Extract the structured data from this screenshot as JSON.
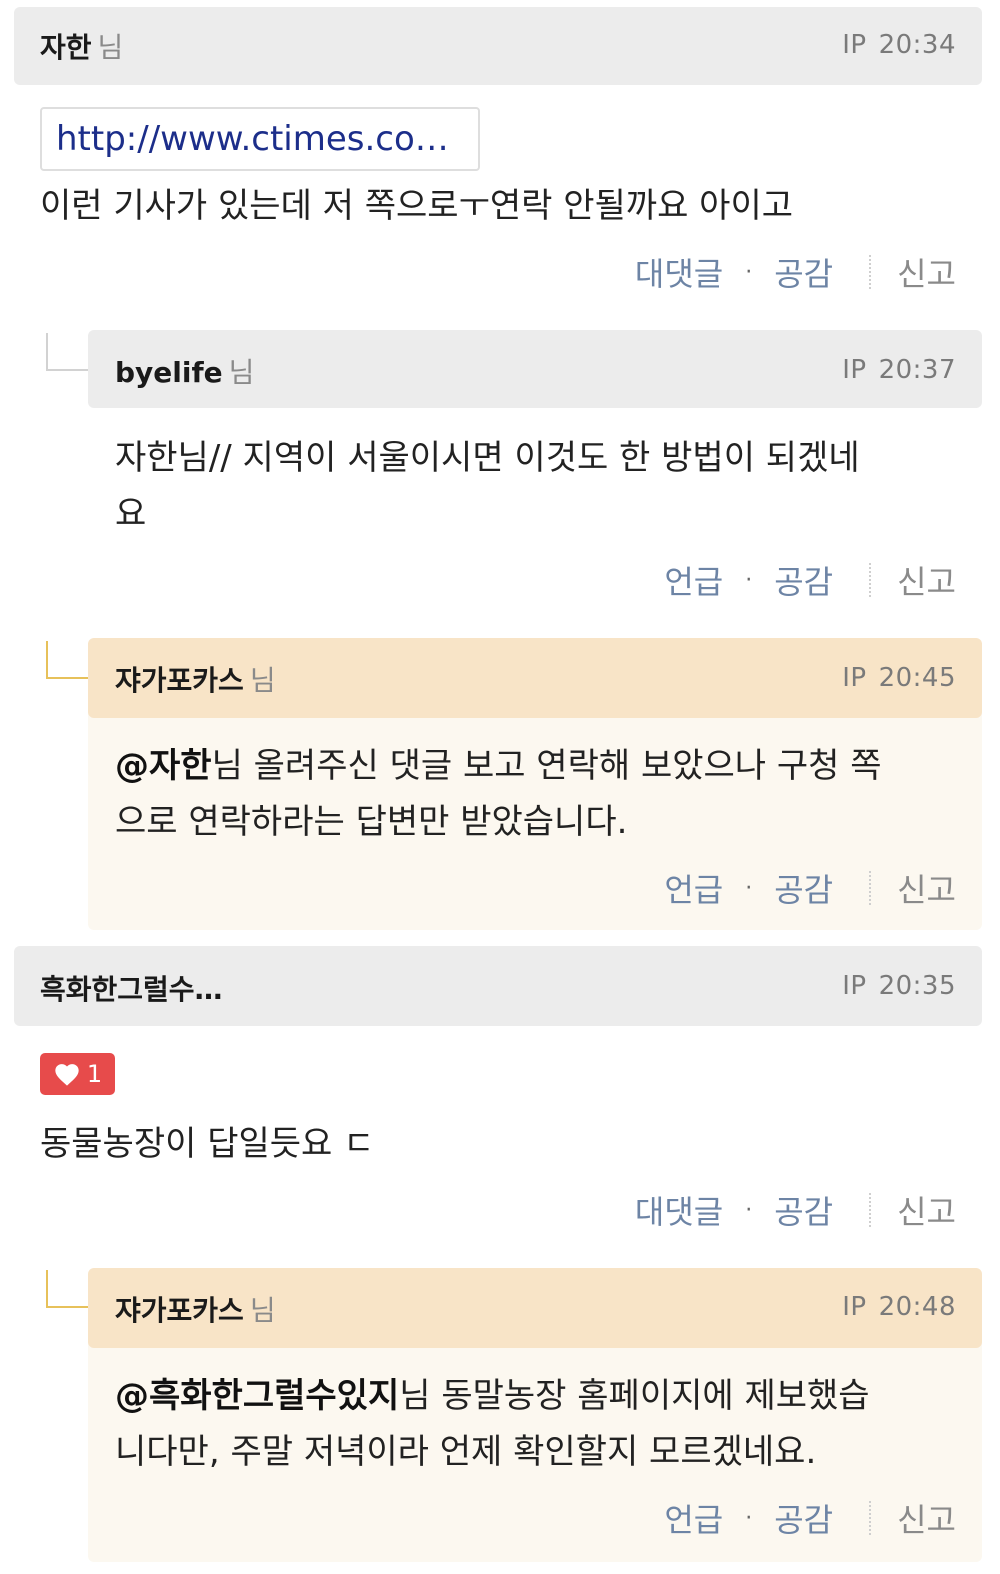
{
  "comments": [
    {
      "author": "자한",
      "suffix": "님",
      "ip_label": "IP",
      "time": "20:34",
      "link_text": "http://www.ctimes.co…",
      "text": "이런 기사가 있는데 저 쪽으로ㅜ연락 안될까요 아이고",
      "actions": {
        "reply": "대댓글",
        "dot": "·",
        "empathy": "공감",
        "report": "신고"
      }
    },
    {
      "author": "byelife",
      "suffix": "님",
      "ip_label": "IP",
      "time": "20:37",
      "text_line1": "자한님// 지역이 서울이시면 이것도 한 방법이 되겠네",
      "text_line2": "요",
      "actions": {
        "reply": "언급",
        "dot": "·",
        "empathy": "공감",
        "report": "신고"
      }
    },
    {
      "author": "쟈가포카스",
      "suffix": "님",
      "ip_label": "IP",
      "time": "20:45",
      "mention": "@자한",
      "text_line1_rest": "님 올려주신 댓글 보고 연락해 보았으나 구청 쪽",
      "text_line2": "으로 연락하라는 답변만 받았습니다.",
      "actions": {
        "reply": "언급",
        "dot": "·",
        "empathy": "공감",
        "report": "신고"
      }
    },
    {
      "author": "흑화한그럴수…",
      "ip_label": "IP",
      "time": "20:35",
      "likes": "1",
      "text": "동물농장이 답일듯요 ㄷ",
      "actions": {
        "reply": "대댓글",
        "dot": "·",
        "empathy": "공감",
        "report": "신고"
      }
    },
    {
      "author": "쟈가포카스",
      "suffix": "님",
      "ip_label": "IP",
      "time": "20:48",
      "mention": "@흑화한그럴수있지",
      "text_line1_rest": "님 동말농장 홈페이지에 제보했습",
      "text_line2": "니다만, 주말 저녁이라 언제 확인할지 모르겠네요.",
      "actions": {
        "reply": "언급",
        "dot": "·",
        "empathy": "공감",
        "report": "신고"
      }
    }
  ],
  "colors": {
    "header_gray": "#ececec",
    "header_tan": "#f8e4c7",
    "body_tan": "#fcf8f0",
    "link": "#1c2e8a",
    "action_link": "#6d84a5",
    "like_badge": "#e74b4b",
    "connector_gold": "#e7c15a"
  },
  "icons": {
    "like": "heart-icon"
  }
}
